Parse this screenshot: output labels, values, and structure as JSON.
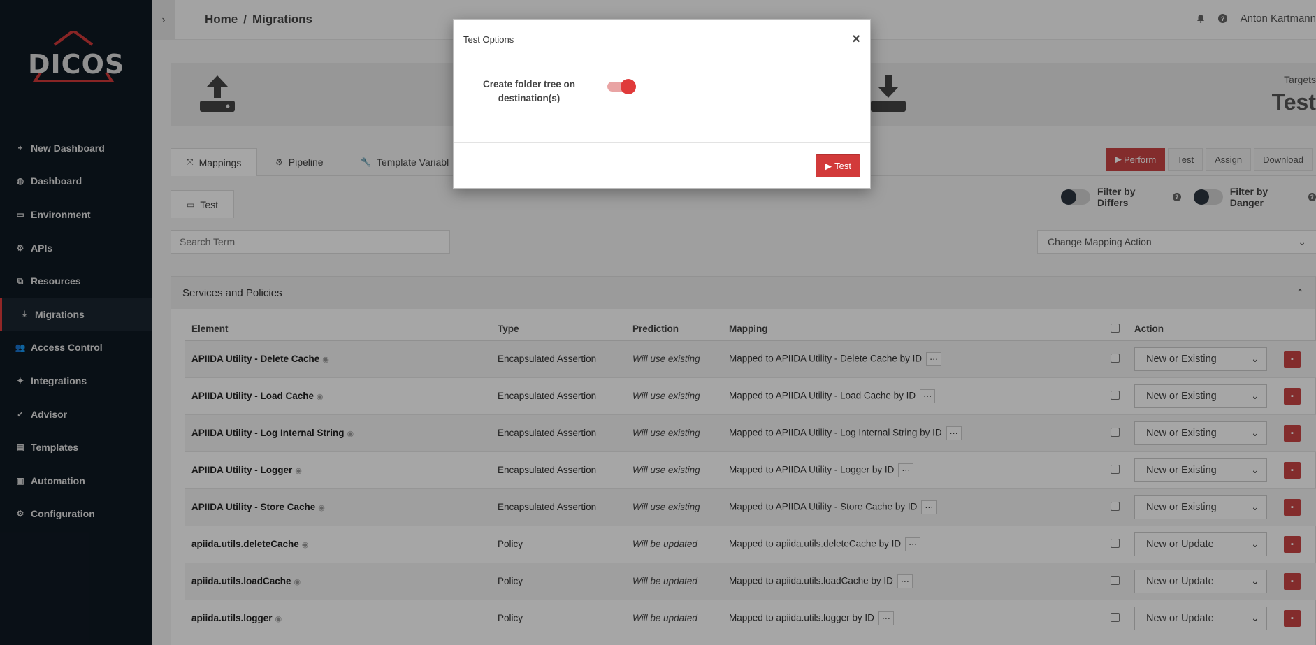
{
  "app": {
    "logo_text": "DICOS"
  },
  "sidebar": {
    "items": [
      {
        "label": "New Dashboard",
        "icon": "plus-icon"
      },
      {
        "label": "Dashboard",
        "icon": "globe-icon"
      },
      {
        "label": "Environment",
        "icon": "monitor-icon"
      },
      {
        "label": "APIs",
        "icon": "cogs-icon"
      },
      {
        "label": "Resources",
        "icon": "copy-icon"
      },
      {
        "label": "Migrations",
        "icon": "download-icon",
        "active": true
      },
      {
        "label": "Access Control",
        "icon": "users-icon"
      },
      {
        "label": "Integrations",
        "icon": "puzzle-icon"
      },
      {
        "label": "Advisor",
        "icon": "check-icon"
      },
      {
        "label": "Templates",
        "icon": "file-icon"
      },
      {
        "label": "Automation",
        "icon": "inbox-icon"
      },
      {
        "label": "Configuration",
        "icon": "gear-icon"
      }
    ]
  },
  "header": {
    "breadcrumb_home": "Home",
    "breadcrumb_sep": "/",
    "breadcrumb_current": "Migrations",
    "user_name": "Anton Kartmann"
  },
  "hero": {
    "targets_label": "Targets",
    "targets_value": "Test"
  },
  "tabs": [
    {
      "label": "Mappings",
      "icon": "compress-icon",
      "active": true
    },
    {
      "label": "Pipeline",
      "icon": "cogs-icon"
    },
    {
      "label": "Template Variabl",
      "icon": "wrench-icon"
    }
  ],
  "toolbar": {
    "perform_label": "Perform",
    "test_label": "Test",
    "assign_label": "Assign",
    "download_label": "Download"
  },
  "filters": {
    "differs_label": "Filter by Differs",
    "danger_label": "Filter by Danger"
  },
  "subtab": {
    "label": "Test",
    "icon": "monitor-icon"
  },
  "search": {
    "placeholder": "Search Term"
  },
  "mapping_action": {
    "label": "Change Mapping Action"
  },
  "panel": {
    "title": "Services and Policies"
  },
  "table": {
    "columns": {
      "element": "Element",
      "type": "Type",
      "prediction": "Prediction",
      "mapping": "Mapping",
      "action": "Action"
    },
    "rows": [
      {
        "element": "APIIDA Utility - Delete Cache",
        "type": "Encapsulated Assertion",
        "prediction": "Will use existing",
        "mapping": "Mapped to APIIDA Utility - Delete Cache by ID",
        "action": "New or Existing"
      },
      {
        "element": "APIIDA Utility - Load Cache",
        "type": "Encapsulated Assertion",
        "prediction": "Will use existing",
        "mapping": "Mapped to APIIDA Utility - Load Cache by ID",
        "action": "New or Existing"
      },
      {
        "element": "APIIDA Utility - Log Internal String",
        "type": "Encapsulated Assertion",
        "prediction": "Will use existing",
        "mapping": "Mapped to APIIDA Utility - Log Internal String by ID",
        "action": "New or Existing"
      },
      {
        "element": "APIIDA Utility - Logger",
        "type": "Encapsulated Assertion",
        "prediction": "Will use existing",
        "mapping": "Mapped to APIIDA Utility - Logger by ID",
        "action": "New or Existing"
      },
      {
        "element": "APIIDA Utility - Store Cache",
        "type": "Encapsulated Assertion",
        "prediction": "Will use existing",
        "mapping": "Mapped to APIIDA Utility - Store Cache by ID",
        "action": "New or Existing"
      },
      {
        "element": "apiida.utils.deleteCache",
        "type": "Policy",
        "prediction": "Will be updated",
        "mapping": "Mapped to apiida.utils.deleteCache by ID",
        "action": "New or Update"
      },
      {
        "element": "apiida.utils.loadCache",
        "type": "Policy",
        "prediction": "Will be updated",
        "mapping": "Mapped to apiida.utils.loadCache by ID",
        "action": "New or Update"
      },
      {
        "element": "apiida.utils.logger",
        "type": "Policy",
        "prediction": "Will be updated",
        "mapping": "Mapped to apiida.utils.logger by ID",
        "action": "New or Update"
      }
    ]
  },
  "modal": {
    "title": "Test Options",
    "option_label": "Create folder tree on destination(s)",
    "option_enabled": true,
    "test_button": "Test"
  },
  "colors": {
    "accent": "#d23a3a",
    "sidebar_bg": "#0f1923"
  }
}
